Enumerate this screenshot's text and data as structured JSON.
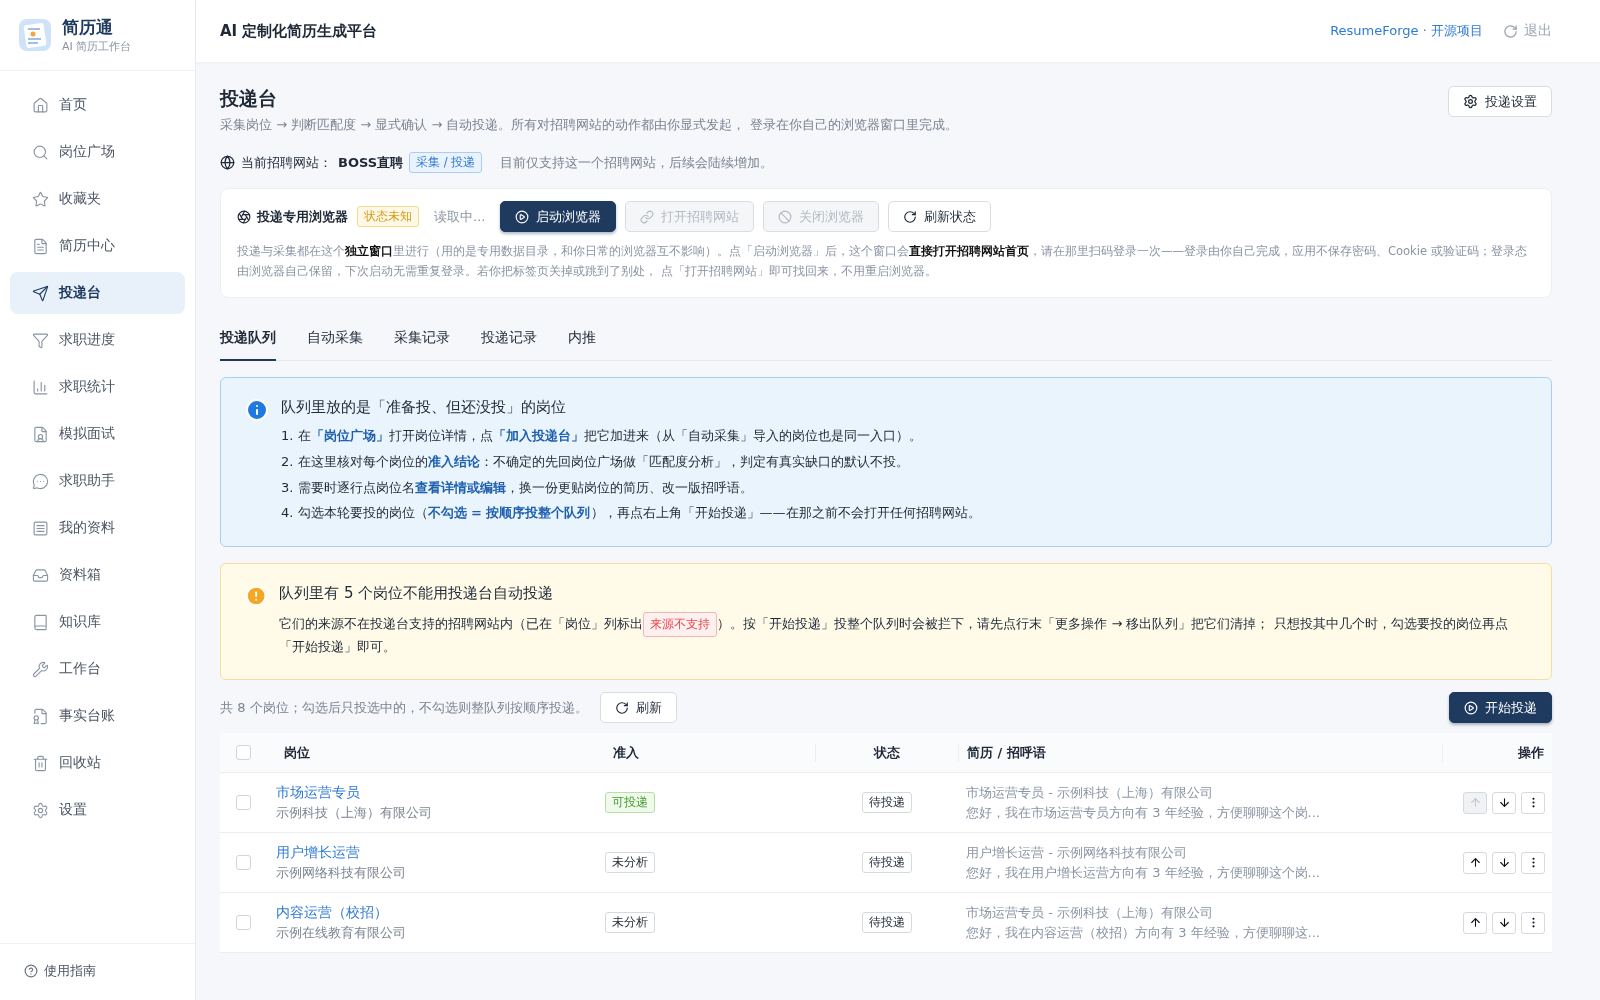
{
  "brand": {
    "name": "简历通",
    "subtitle": "AI 简历工作台"
  },
  "sidebar": {
    "items": [
      {
        "label": "首页",
        "selected": false
      },
      {
        "label": "岗位广场",
        "selected": false
      },
      {
        "label": "收藏夹",
        "selected": false
      },
      {
        "label": "简历中心",
        "selected": false
      },
      {
        "label": "投递台",
        "selected": true
      },
      {
        "label": "求职进度",
        "selected": false
      },
      {
        "label": "求职统计",
        "selected": false
      },
      {
        "label": "模拟面试",
        "selected": false
      },
      {
        "label": "求职助手",
        "selected": false
      },
      {
        "label": "我的资料",
        "selected": false
      },
      {
        "label": "资料箱",
        "selected": false
      },
      {
        "label": "知识库",
        "selected": false
      },
      {
        "label": "工作台",
        "selected": false
      },
      {
        "label": "事实台账",
        "selected": false
      },
      {
        "label": "回收站",
        "selected": false
      },
      {
        "label": "设置",
        "selected": false
      }
    ],
    "footer": "使用指南"
  },
  "header": {
    "title": "AI 定制化简历生成平台",
    "link": "ResumeForge · 开源项目",
    "logout": "退出"
  },
  "page": {
    "title": "投递台",
    "subtitle": "采集岗位 → 判断匹配度 → 显式确认 → 自动投递。所有对招聘网站的动作都由你显式发起， 登录在你自己的浏览器窗口里完成。",
    "settings_button": "投递设置",
    "site_label": "当前招聘网站：",
    "site_name": "BOSS直聘",
    "site_tag": "采集 / 投递",
    "site_note": "目前仅支持这一个招聘网站，后续会陆续增加。"
  },
  "browser_card": {
    "title": "投递专用浏览器",
    "status": "状态未知",
    "reading": "读取中...",
    "buttons": [
      {
        "label": "启动浏览器",
        "kind": "primary",
        "disabled": false
      },
      {
        "label": "打开招聘网站",
        "kind": "default",
        "disabled": true
      },
      {
        "label": "关闭浏览器",
        "kind": "default",
        "disabled": true
      },
      {
        "label": "刷新状态",
        "kind": "default",
        "disabled": false
      }
    ],
    "description": "投递与采集都在这个**独立窗口**里进行（用的是专用数据目录，和你日常的浏览器互不影响）。点「启动浏览器」后，这个窗口会**直接打开招聘网站首页**，请在那里扫码登录一次——登录由你自己完成，应用不保存密码、Cookie 或验证码；登录态由浏览器自己保留，下次启动无需重复登录。若你把标签页关掉或跳到了别处， 点「打开招聘网站」即可找回来，不用重启浏览器。"
  },
  "tabs": [
    {
      "label": "投递队列",
      "selected": true
    },
    {
      "label": "自动采集",
      "selected": false
    },
    {
      "label": "采集记录",
      "selected": false
    },
    {
      "label": "投递记录",
      "selected": false
    },
    {
      "label": "内推",
      "selected": false
    }
  ],
  "info_notice": {
    "title": "队列里放的是「准备投、但还没投」的岗位",
    "steps": [
      "1. 在**「岗位广场」**打开岗位详情，点**「加入投递台」**把它加进来（从「自动采集」导入的岗位也是同一入口）。",
      "2. 在这里核对每个岗位的**准入结论**：不确定的先回岗位广场做「匹配度分析」，判定有真实缺口的默认不投。",
      "3. 需要时逐行点岗位名**查看详情或编辑**，换一份更贴岗位的简历、改一版招呼语。",
      "4. 勾选本轮要投的岗位（**不勾选 = 按顺序投整个队列**），再点右上角「开始投递」——在那之前不会打开任何招聘网站。"
    ]
  },
  "warning_notice": {
    "title": "队列里有 5 个岗位不能用投递台自动投递",
    "text_before": "它们的来源不在投递台支持的招聘网站内（已在「岗位」列标出",
    "tag": "来源不支持",
    "text_after": "）。按「开始投递」投整个队列时会被拦下，请先点行末「更多操作 → 移出队列」把它们清掉； 只想投其中几个时，勾选要投的岗位再点「开始投递」即可。"
  },
  "queue": {
    "summary": "共 8 个岗位；勾选后只投选中的，不勾选则整队列按顺序投递。",
    "refresh": "刷新",
    "start": "开始投递",
    "columns": [
      "岗位",
      "准入",
      "状态",
      "简历 / 招呼语",
      "操作"
    ],
    "select_all_checked": false,
    "rows": [
      {
        "title": "市场运营专员",
        "company": "示例科技（上海）有限公司",
        "admission": {
          "label": "可投递",
          "kind": "ok"
        },
        "status": "待投递",
        "resume": "市场运营专员 - 示例科技（上海）有限公司",
        "greeting": "您好，我在市场运营专员方向有 3 年经验，方便聊聊这个岗...",
        "checked": false,
        "up_disabled": true
      },
      {
        "title": "用户增长运营",
        "company": "示例网络科技有限公司",
        "admission": {
          "label": "未分析",
          "kind": "none"
        },
        "status": "待投递",
        "resume": "用户增长运营 - 示例网络科技有限公司",
        "greeting": "您好，我在用户增长运营方向有 3 年经验，方便聊聊这个岗...",
        "checked": false,
        "up_disabled": false
      },
      {
        "title": "内容运营（校招）",
        "company": "示例在线教育有限公司",
        "admission": {
          "label": "未分析",
          "kind": "none"
        },
        "status": "待投递",
        "resume": "市场运营专员 - 示例科技（上海）有限公司",
        "greeting": "您好，我在内容运营（校招）方向有 3 年经验，方便聊聊这...",
        "checked": false,
        "up_disabled": false
      }
    ]
  }
}
